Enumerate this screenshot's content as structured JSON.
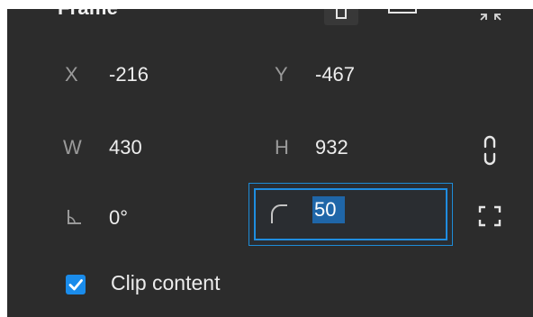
{
  "header": {
    "title": "Frame",
    "icons": [
      "frame-portrait-icon",
      "frame-landscape-icon",
      "collapse-icon"
    ]
  },
  "position": {
    "x_label": "X",
    "x_value": "-216",
    "y_label": "Y",
    "y_value": "-467"
  },
  "size": {
    "w_label": "W",
    "w_value": "430",
    "h_label": "H",
    "h_value": "932",
    "lock_icon": "constrain-proportions-icon"
  },
  "transform": {
    "rotation_icon": "rotation-angle-icon",
    "rotation_value": "0°",
    "radius_icon": "corner-radius-icon",
    "radius_value": "50",
    "independent_corners_icon": "independent-corners-icon"
  },
  "clip": {
    "label": "Clip content",
    "checked": true
  },
  "colors": {
    "panel_bg": "#2c2c2c",
    "accent": "#1a8ceb",
    "selection": "#1f66a8"
  }
}
